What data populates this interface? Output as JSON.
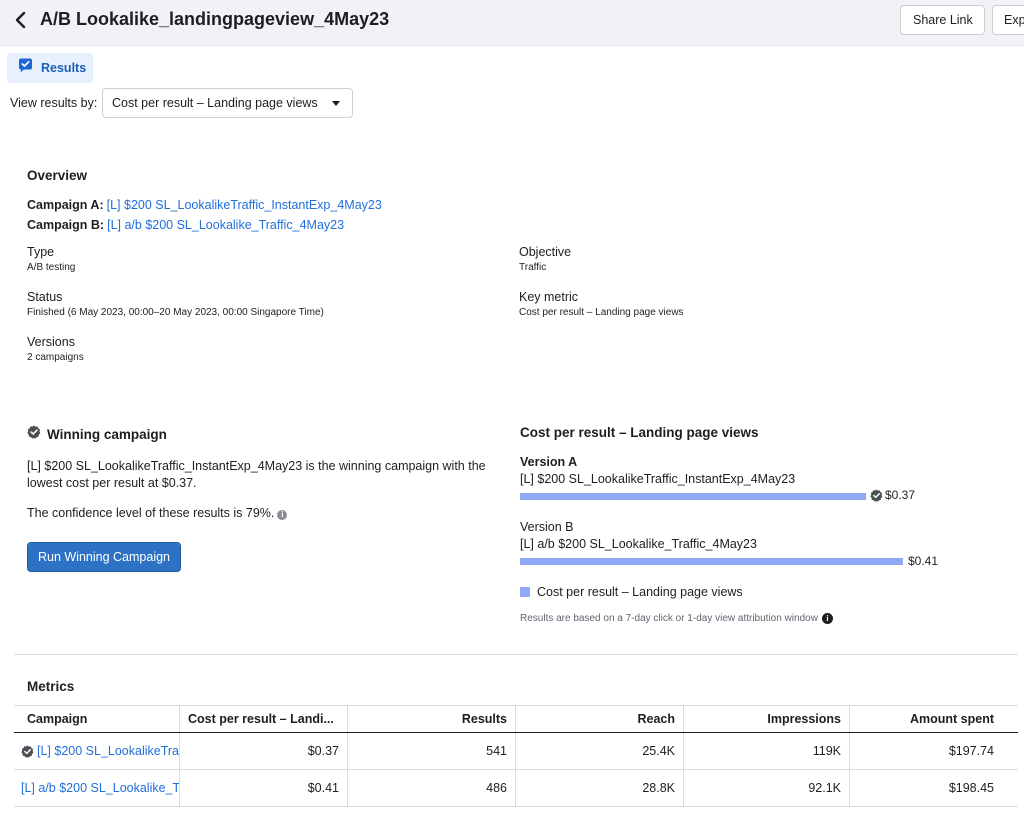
{
  "header": {
    "title": "A/B Lookalike_landingpageview_4May23",
    "share_label": "Share Link",
    "export_label": "Exp"
  },
  "tabs": {
    "results_label": "Results"
  },
  "view_by": {
    "label": "View results by:",
    "selected": "Cost per result – Landing page views"
  },
  "overview": {
    "heading": "Overview",
    "campaign_a_key": "Campaign A:",
    "campaign_a_name": "[L] $200 SL_LookalikeTraffic_InstantExp_4May23",
    "campaign_b_key": "Campaign B:",
    "campaign_b_name": "[L] a/b $200 SL_Lookalike_Traffic_4May23",
    "type_label": "Type",
    "type_value": "A/B testing",
    "objective_label": "Objective",
    "objective_value": "Traffic",
    "status_label": "Status",
    "status_value": "Finished (6 May 2023, 00:00–20 May 2023, 00:00 Singapore Time)",
    "key_metric_label": "Key metric",
    "key_metric_value": "Cost per result – Landing page views",
    "versions_label": "Versions",
    "versions_value": "2 campaigns"
  },
  "winning": {
    "heading": "Winning campaign",
    "line1": "[L] $200 SL_LookalikeTraffic_InstantExp_4May23 is the winning campaign with the",
    "line2": "lowest cost per result at $0.37.",
    "confidence": "The confidence level of these results is 79%.",
    "button": "Run Winning Campaign"
  },
  "chart_data": {
    "type": "bar",
    "title": "Cost per result – Landing page views",
    "categories": [
      "Version A",
      "Version B"
    ],
    "category_names": [
      "[L] $200 SL_LookalikeTraffic_InstantExp_4May23",
      "[L] a/b $200 SL_Lookalike_Traffic_4May23"
    ],
    "values": [
      0.37,
      0.41
    ],
    "value_labels": [
      "$0.37",
      "$0.41"
    ],
    "winner_index": 0,
    "legend": "Cost per result – Landing page views",
    "note": "Results are based on a 7-day click or 1-day view attribution window",
    "bar_color": "#90a9f4"
  },
  "metrics": {
    "heading": "Metrics",
    "columns": [
      "Campaign",
      "Cost per result – Landi...",
      "Results",
      "Reach",
      "Impressions",
      "Amount spent"
    ],
    "rows": [
      [
        "[L] $200 SL_LookalikeTra",
        "$0.37",
        "541",
        "25.4K",
        "119K",
        "$197.74"
      ],
      [
        "[L] a/b $200 SL_Lookalike_T",
        "$0.41",
        "486",
        "28.8K",
        "92.1K",
        "$198.45"
      ]
    ]
  },
  "colors": {
    "link": "#216fdb",
    "primary": "#2d72c4",
    "header_bg": "#f0f2f5"
  }
}
